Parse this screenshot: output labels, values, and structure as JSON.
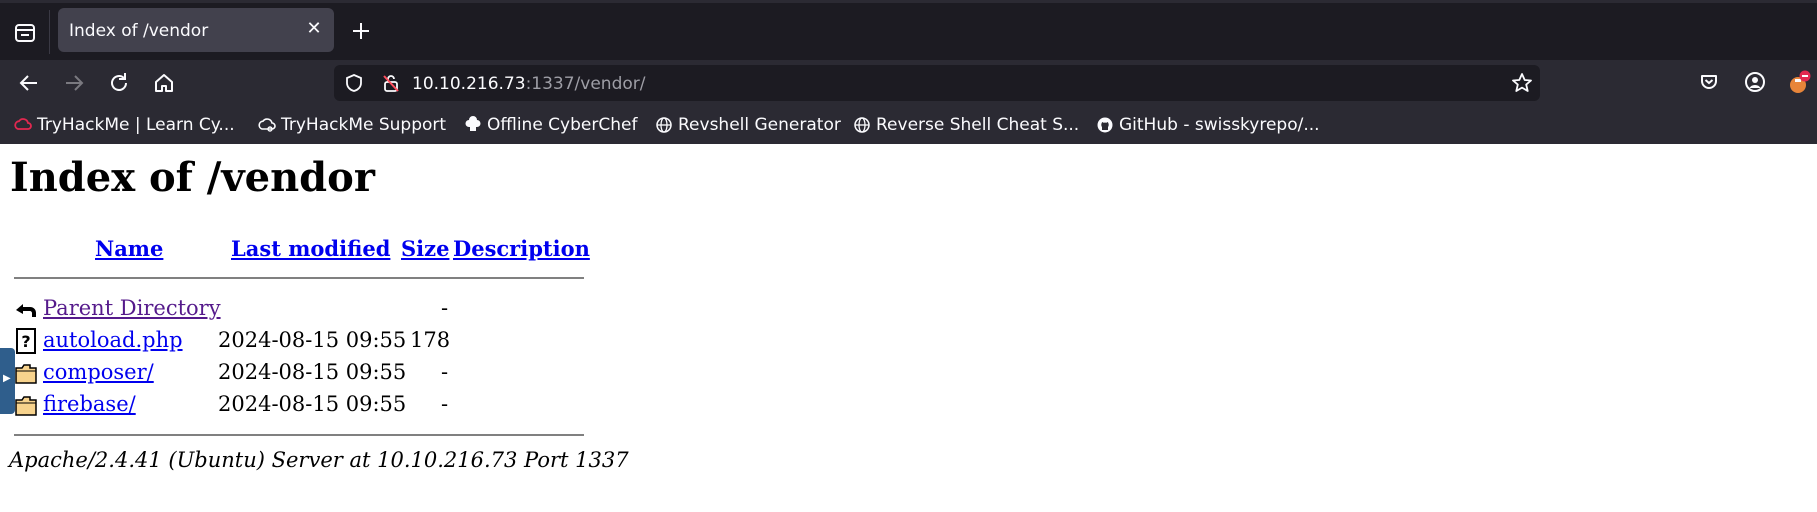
{
  "browser": {
    "tab": {
      "title": "Index of /vendor"
    },
    "url": {
      "host": "10.10.216.73",
      "rest": ":1337/vendor/"
    },
    "bookmarks": [
      {
        "label": "TryHackMe | Learn Cy...",
        "icon": "tryhackme-icon"
      },
      {
        "label": "TryHackMe Support",
        "icon": "cloud-icon"
      },
      {
        "label": "Offline CyberChef",
        "icon": "chef-hat-icon"
      },
      {
        "label": "Revshell Generator",
        "icon": "globe-icon"
      },
      {
        "label": "Reverse Shell Cheat S...",
        "icon": "globe-icon"
      },
      {
        "label": "GitHub - swisskyrepo/...",
        "icon": "github-icon"
      }
    ]
  },
  "page": {
    "title": "Index of /vendor",
    "columns": {
      "name": "Name",
      "modified": "Last modified",
      "size": "Size",
      "description": "Description"
    },
    "rows": [
      {
        "name": "Parent Directory",
        "modified": "",
        "size": "-",
        "icon": "back-arrow-icon"
      },
      {
        "name": "autoload.php",
        "modified": "2024-08-15 09:55",
        "size": "178",
        "icon": "unknown-file-icon"
      },
      {
        "name": "composer/",
        "modified": "2024-08-15 09:55",
        "size": "-",
        "icon": "folder-icon"
      },
      {
        "name": "firebase/",
        "modified": "2024-08-15 09:55",
        "size": "-",
        "icon": "folder-icon"
      }
    ],
    "address": "Apache/2.4.41 (Ubuntu) Server at 10.10.216.73 Port 1337"
  }
}
